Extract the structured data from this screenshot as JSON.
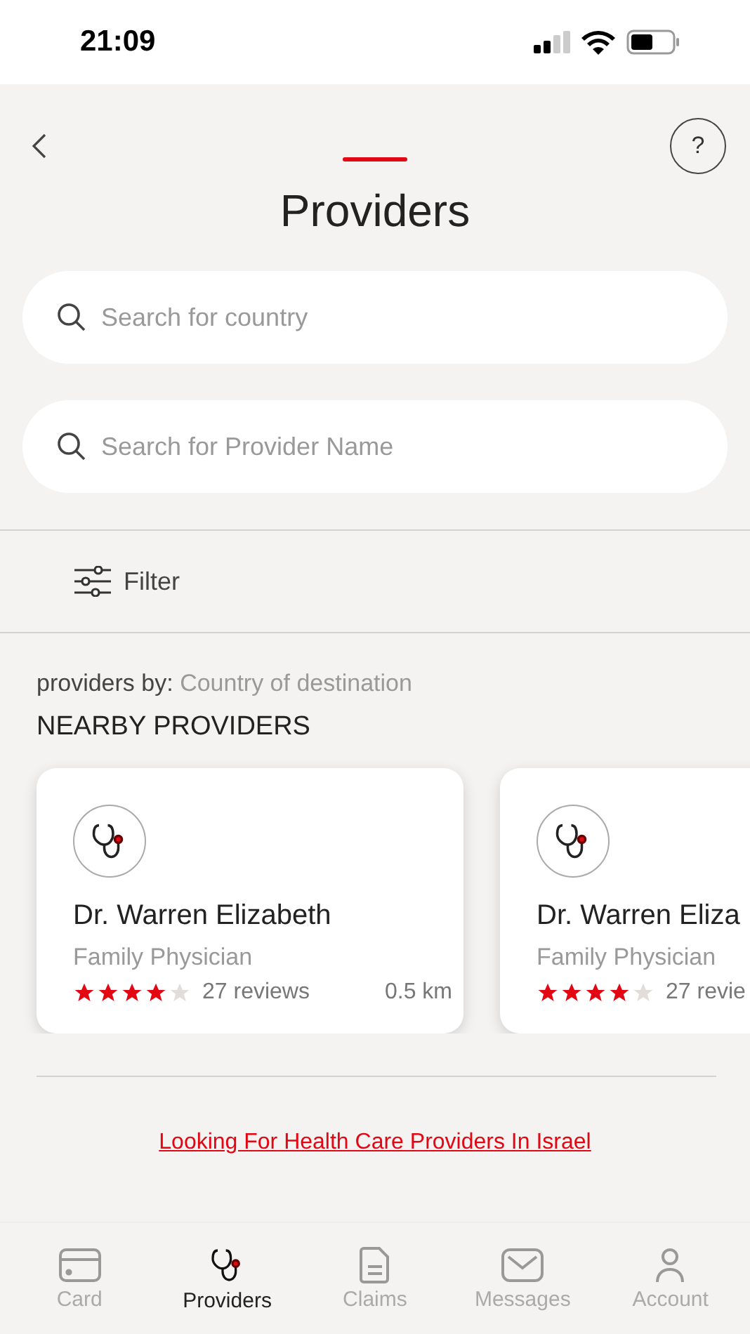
{
  "status_bar": {
    "time": "21:09"
  },
  "header": {
    "title": "Providers",
    "help": "?"
  },
  "search_fields": [
    {
      "placeholder": "Search for country"
    },
    {
      "placeholder": "Search for Provider Name"
    }
  ],
  "filter": {
    "label": "Filter"
  },
  "section": {
    "prefix": "providers by:",
    "value": "Country of destination",
    "heading": "NEARBY PROVIDERS"
  },
  "providers": [
    {
      "name": "Dr. Warren Elizabeth",
      "specialty": "Family Physician",
      "stars": 4,
      "reviews": "27 reviews",
      "distance": "0.5 km"
    },
    {
      "name": "Dr. Warren Eliza",
      "specialty": "Family Physician",
      "stars": 4,
      "reviews": "27 revie"
    }
  ],
  "link": "Looking For Health Care Providers In Israel",
  "tab_bar": [
    {
      "label": "Card",
      "kind": "card",
      "selected": false
    },
    {
      "label": "Providers",
      "kind": "stethoscope",
      "selected": true
    },
    {
      "label": "Claims",
      "kind": "document",
      "selected": false
    },
    {
      "label": "Messages",
      "kind": "mail",
      "selected": false
    },
    {
      "label": "Account",
      "kind": "person",
      "selected": false
    }
  ]
}
